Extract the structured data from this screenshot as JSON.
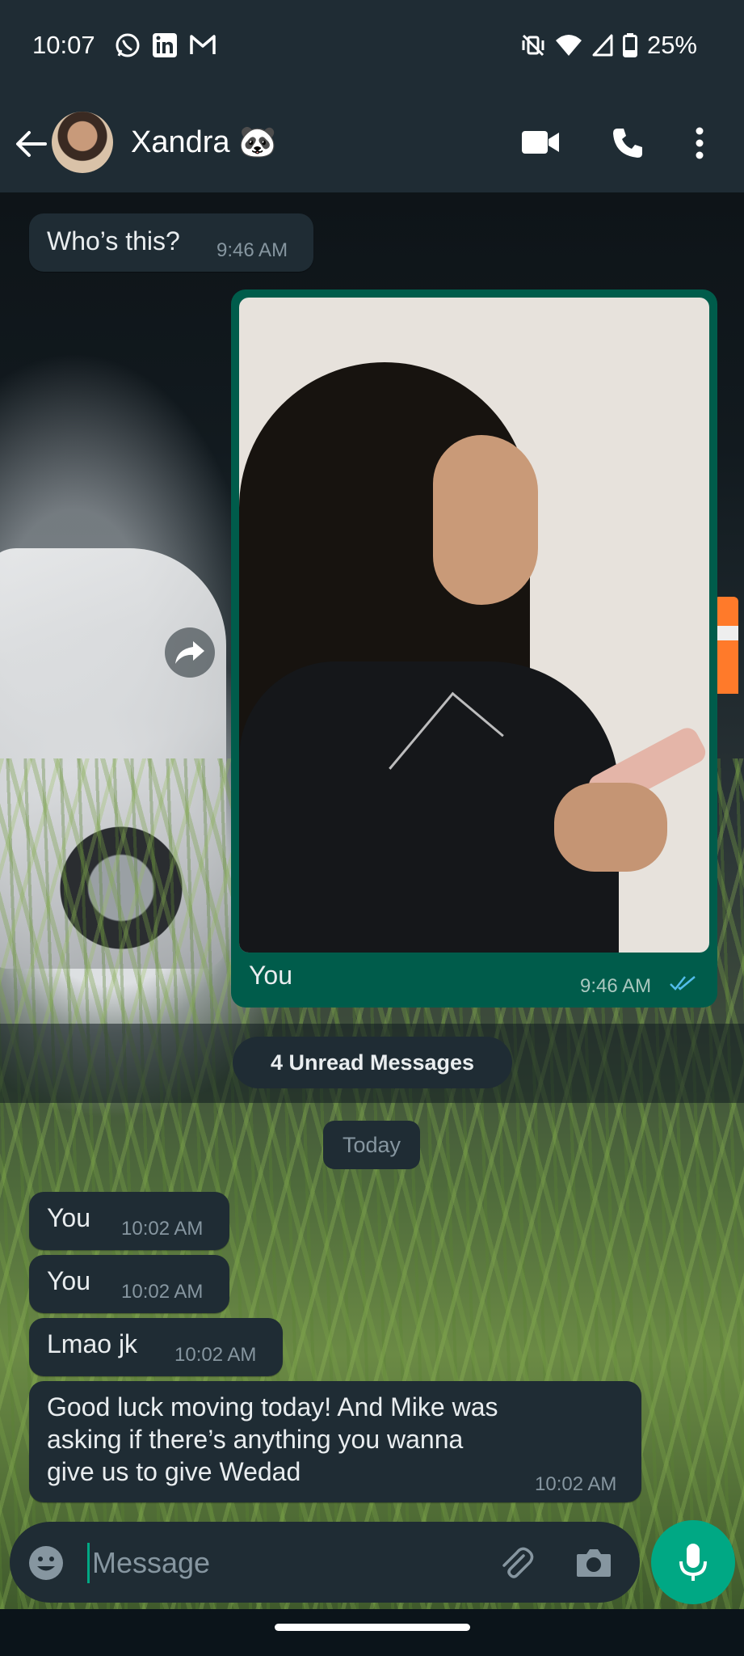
{
  "status_bar": {
    "time": "10:07",
    "battery": "25%",
    "left_icons": [
      "whatsapp-icon",
      "linkedin-icon",
      "gmail-icon"
    ],
    "right_icons": [
      "vibrate-off-icon",
      "wifi-icon",
      "signal-icon",
      "battery-icon"
    ]
  },
  "header": {
    "contact_name": "Xandra 🐼",
    "actions": [
      "video-call-icon",
      "phone-call-icon",
      "more-options-icon"
    ]
  },
  "messages": [
    {
      "direction": "in",
      "text": "Who’s this?",
      "time": "9:46 AM"
    },
    {
      "direction": "out",
      "type": "image",
      "caption": "You",
      "time": "9:46 AM",
      "status": "read"
    },
    {
      "direction": "in",
      "text": "You",
      "time": "10:02 AM"
    },
    {
      "direction": "in",
      "text": "You",
      "time": "10:02 AM"
    },
    {
      "direction": "in",
      "text": "Lmao jk",
      "time": "10:02 AM"
    },
    {
      "direction": "in",
      "text": "Good luck moving today! And Mike was asking if there’s anything you wanna give us to give Wedad",
      "time": "10:02 AM"
    }
  ],
  "unread_label": "4 Unread Messages",
  "date_label": "Today",
  "composer": {
    "placeholder": "Message",
    "icons": [
      "emoji-icon",
      "attach-icon",
      "camera-icon",
      "mic-icon"
    ]
  },
  "colors": {
    "header_bg": "#1f2c34",
    "incoming_bubble": "#1f2c34",
    "outgoing_bubble": "#005c4b",
    "accent": "#00a884",
    "read_ticks": "#53bdeb"
  }
}
